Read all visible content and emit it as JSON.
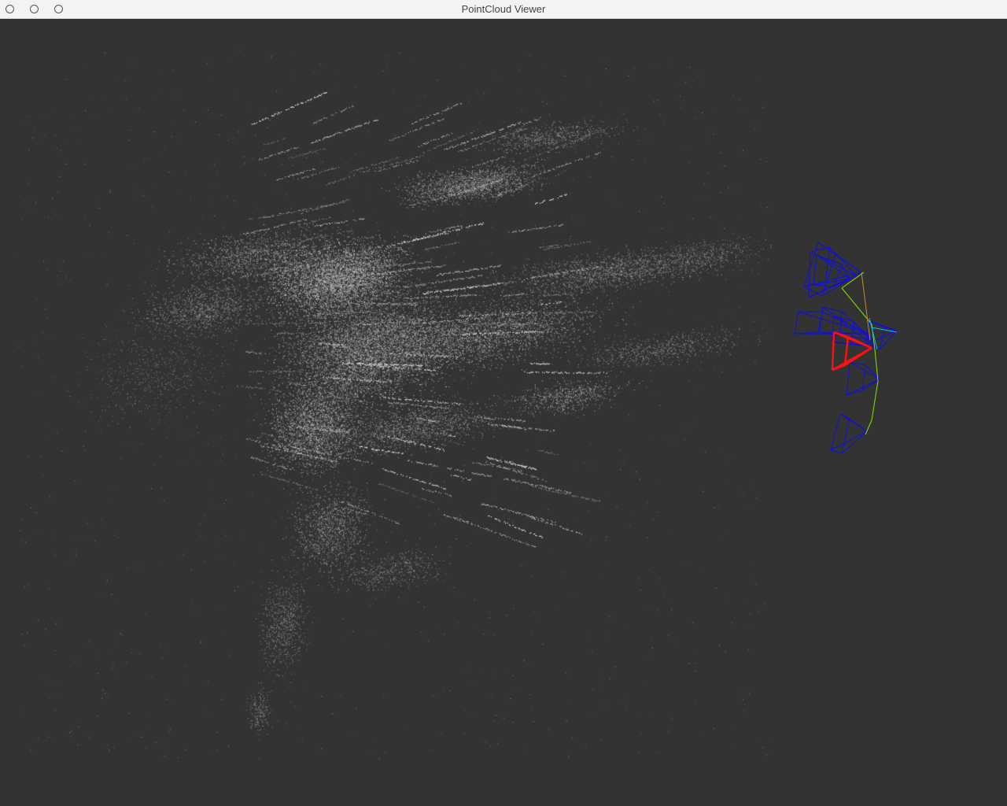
{
  "window": {
    "title": "PointCloud Viewer",
    "buttons": [
      "close",
      "minimize",
      "maximize"
    ]
  },
  "viewport": {
    "background_color": "#333333",
    "point_color": "#d0d0d0",
    "trajectory_color": "#8ee000",
    "keyframe_color": "#1010d8",
    "current_camera_color": "#ff1010",
    "covisibility_color": "#00c0ff"
  }
}
